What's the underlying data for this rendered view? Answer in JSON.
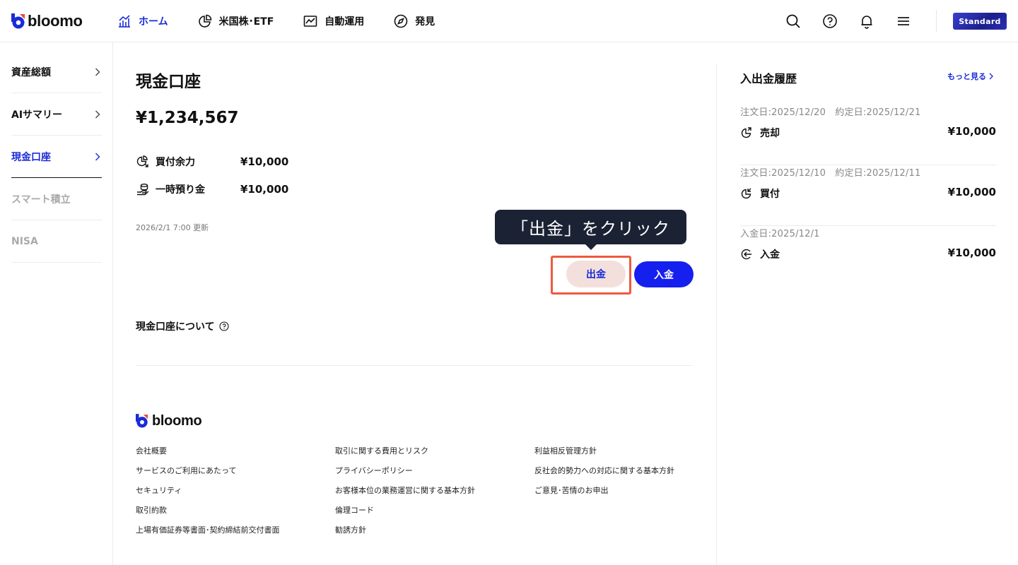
{
  "brand": {
    "name": "bloomo",
    "accent": "#1a2bd8",
    "plan": "Standard"
  },
  "nav": [
    {
      "label": "ホーム",
      "icon": "home-chart-icon",
      "active": true
    },
    {
      "label": "米国株･ETF",
      "icon": "pie-chart-icon",
      "active": false
    },
    {
      "label": "自動運用",
      "icon": "line-chart-icon",
      "active": false
    },
    {
      "label": "発見",
      "icon": "compass-icon",
      "active": false
    }
  ],
  "header_icons": [
    "search-icon",
    "help-icon",
    "bell-icon",
    "menu-icon"
  ],
  "sidebar": {
    "items": [
      {
        "label": "資産総額",
        "state": "normal"
      },
      {
        "label": "AIサマリー",
        "state": "normal"
      },
      {
        "label": "現金口座",
        "state": "active"
      },
      {
        "label": "スマート積立",
        "state": "disabled"
      },
      {
        "label": "NISA",
        "state": "disabled"
      }
    ]
  },
  "main": {
    "title": "現金口座",
    "balance": "¥1,234,567",
    "rows": [
      {
        "label": "買付余力",
        "value": "¥10,000",
        "icon": "buying-power-icon"
      },
      {
        "label": "一時預り金",
        "value": "¥10,000",
        "icon": "coins-icon"
      }
    ],
    "updated": "2026/2/1 7:00 更新",
    "tooltip": "「出金」をクリック",
    "withdraw_label": "出金",
    "deposit_label": "入金",
    "about_label": "現金口座について"
  },
  "footer": {
    "logo": "bloomo",
    "columns": [
      [
        "会社概要",
        "サービスのご利用にあたって",
        "セキュリティ",
        "取引約款",
        "上場有価証券等書面･契約締結前交付書面"
      ],
      [
        "取引に関する費用とリスク",
        "プライバシーポリシー",
        "お客様本位の業務運営に関する基本方針",
        "倫理コード",
        "勧誘方針"
      ],
      [
        "利益相反管理方針",
        "反社会的勢力への対応に関する基本方針",
        "ご意見･苦情のお申出"
      ]
    ]
  },
  "history": {
    "title": "入出金履歴",
    "more_label": "もっと見る",
    "items": [
      {
        "meta": "注文日:2025/12/20　約定日:2025/12/21",
        "type": "売却",
        "amount": "¥10,000",
        "icon": "sell-icon"
      },
      {
        "meta": "注文日:2025/12/10　約定日:2025/12/11",
        "type": "買付",
        "amount": "¥10,000",
        "icon": "buy-icon"
      },
      {
        "meta": "入金日:2025/12/1",
        "type": "入金",
        "amount": "¥10,000",
        "icon": "deposit-icon"
      }
    ]
  }
}
